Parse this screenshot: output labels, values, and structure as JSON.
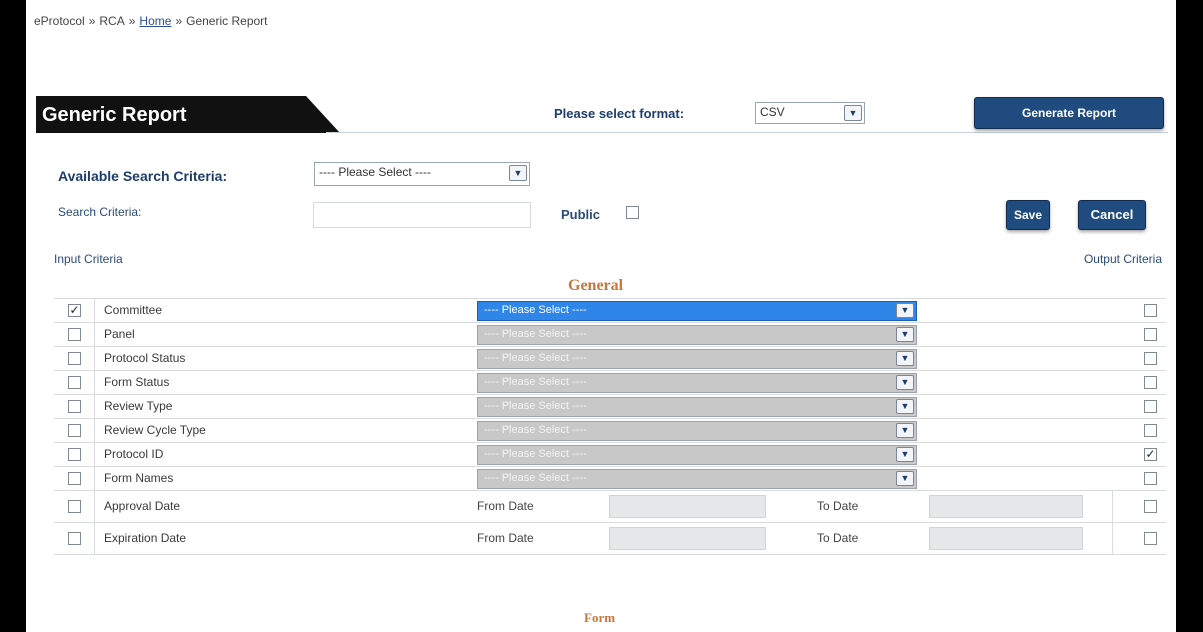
{
  "breadcrumb": {
    "part1": "eProtocol",
    "part2": "RCA",
    "home": "Home",
    "current": "Generic Report",
    "sep": "»"
  },
  "header": {
    "title": "Generic Report",
    "format_label": "Please select format:",
    "format_value": "CSV",
    "generate_label": "Generate Report"
  },
  "criteria": {
    "available_label": "Available Search Criteria:",
    "available_value": "---- Please Select ----",
    "search_label": "Search Criteria:",
    "search_value": "",
    "public_label": "Public",
    "save_label": "Save",
    "cancel_label": "Cancel",
    "input_label": "Input Criteria",
    "output_label": "Output Criteria"
  },
  "sections": {
    "general": "General",
    "form": "Form"
  },
  "select_placeholder": "---- Please Select ----",
  "date_labels": {
    "from": "From Date",
    "to": "To Date"
  },
  "rows": [
    {
      "label": "Committee",
      "input_checked": true,
      "output_checked": false,
      "active": true
    },
    {
      "label": "Panel",
      "input_checked": false,
      "output_checked": false,
      "active": false
    },
    {
      "label": "Protocol Status",
      "input_checked": false,
      "output_checked": false,
      "active": false
    },
    {
      "label": "Form Status",
      "input_checked": false,
      "output_checked": false,
      "active": false
    },
    {
      "label": "Review Type",
      "input_checked": false,
      "output_checked": false,
      "active": false
    },
    {
      "label": "Review Cycle Type",
      "input_checked": false,
      "output_checked": false,
      "active": false
    },
    {
      "label": "Protocol ID",
      "input_checked": false,
      "output_checked": true,
      "active": false
    },
    {
      "label": "Form Names",
      "input_checked": false,
      "output_checked": false,
      "active": false
    }
  ],
  "date_rows": [
    {
      "label": "Approval Date",
      "input_checked": false,
      "output_checked": false
    },
    {
      "label": "Expiration Date",
      "input_checked": false,
      "output_checked": false
    }
  ],
  "colors": {
    "accent": "#1f4b7e",
    "section": "#c8773a",
    "active_select": "#2f86e8",
    "disabled_select": "#c8c8c8"
  }
}
